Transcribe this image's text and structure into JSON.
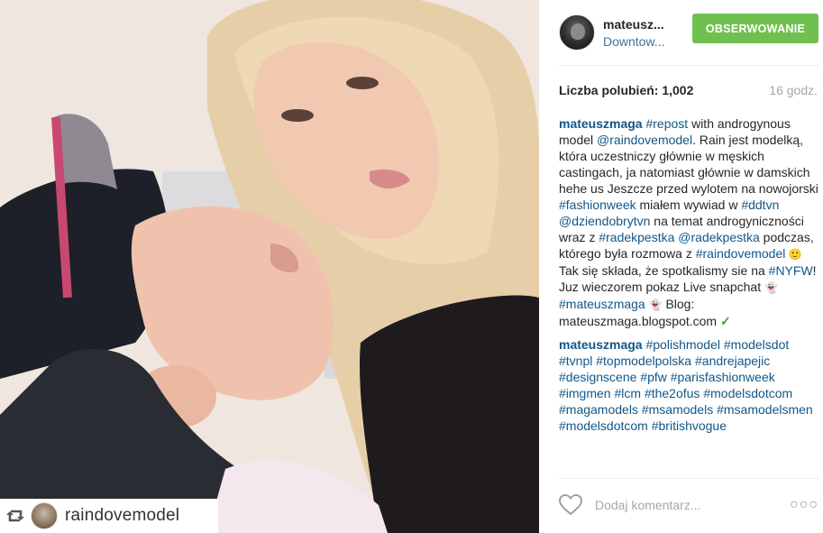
{
  "photo": {
    "repost": {
      "icon": "repost-icon",
      "username": "raindovemodel"
    }
  },
  "post": {
    "author": {
      "username": "mateusz...",
      "location": "Downtow..."
    },
    "follow_label": "OBSERWOWANIE",
    "likes_label": "Liczba polubień: 1,002",
    "time_label": "16 godz.",
    "comments": [
      {
        "user": "mateuszmaga",
        "segments": [
          {
            "t": "tag",
            "v": "#repost"
          },
          {
            "t": "text",
            "v": " with androgynous model "
          },
          {
            "t": "tag",
            "v": "@raindovemodel"
          },
          {
            "t": "text",
            "v": ". Rain jest modelką, która uczestniczy głównie w męskich castingach, ja natomiast głównie w damskich hehe us Jeszcze przed wylotem na nowojorski "
          },
          {
            "t": "tag",
            "v": "#fashionweek"
          },
          {
            "t": "text",
            "v": " miałem wywiad w "
          },
          {
            "t": "tag",
            "v": "#ddtvn"
          },
          {
            "t": "text",
            "v": " "
          },
          {
            "t": "tag",
            "v": "@dziendobrytvn"
          },
          {
            "t": "text",
            "v": " na temat androgyniczności wraz z "
          },
          {
            "t": "tag",
            "v": "#radekpestka"
          },
          {
            "t": "text",
            "v": " "
          },
          {
            "t": "tag",
            "v": "@radekpestka"
          },
          {
            "t": "text",
            "v": " podczas, którego była rozmowa z "
          },
          {
            "t": "tag",
            "v": "#raindovemodel"
          },
          {
            "t": "emoji",
            "v": " 🙂"
          },
          {
            "t": "text",
            "v": " Tak się składa, że spotkalismy sie na "
          },
          {
            "t": "tag",
            "v": "#NYFW"
          },
          {
            "t": "text",
            "v": "! Juz wieczorem pokaz Live snapchat "
          },
          {
            "t": "emoji",
            "v": "👻"
          },
          {
            "t": "text",
            "v": " "
          },
          {
            "t": "tag",
            "v": "#mateuszmaga"
          },
          {
            "t": "text",
            "v": " "
          },
          {
            "t": "emoji",
            "v": "👻"
          },
          {
            "t": "text",
            "v": " Blog: mateuszmaga.blogspot.com "
          },
          {
            "t": "check",
            "v": "✓"
          }
        ]
      },
      {
        "user": "mateuszmaga",
        "segments": [
          {
            "t": "tag",
            "v": "#polishmodel"
          },
          {
            "t": "text",
            "v": " "
          },
          {
            "t": "tag",
            "v": "#modelsdot"
          },
          {
            "t": "text",
            "v": " "
          },
          {
            "t": "tag",
            "v": "#tvnpl"
          },
          {
            "t": "text",
            "v": " "
          },
          {
            "t": "tag",
            "v": "#topmodelpolska"
          },
          {
            "t": "text",
            "v": " "
          },
          {
            "t": "tag",
            "v": "#andrejapejic"
          },
          {
            "t": "text",
            "v": " "
          },
          {
            "t": "tag",
            "v": "#designscene"
          },
          {
            "t": "text",
            "v": " "
          },
          {
            "t": "tag",
            "v": "#pfw"
          },
          {
            "t": "text",
            "v": " "
          },
          {
            "t": "tag",
            "v": "#parisfashionweek"
          },
          {
            "t": "text",
            "v": " "
          },
          {
            "t": "tag",
            "v": "#imgmen"
          },
          {
            "t": "text",
            "v": " "
          },
          {
            "t": "tag",
            "v": "#lcm"
          },
          {
            "t": "text",
            "v": " "
          },
          {
            "t": "tag",
            "v": "#the2ofus"
          },
          {
            "t": "text",
            "v": " "
          },
          {
            "t": "tag",
            "v": "#modelsdotcom"
          },
          {
            "t": "text",
            "v": " "
          },
          {
            "t": "tag",
            "v": "#magamodels"
          },
          {
            "t": "text",
            "v": " "
          },
          {
            "t": "tag",
            "v": "#msamodels"
          },
          {
            "t": "text",
            "v": " "
          },
          {
            "t": "tag",
            "v": "#msamodelsmen"
          },
          {
            "t": "text",
            "v": " "
          },
          {
            "t": "tag",
            "v": "#modelsdotcom"
          },
          {
            "t": "text",
            "v": " "
          },
          {
            "t": "tag",
            "v": "#britishvogue"
          }
        ]
      }
    ],
    "footer": {
      "like_icon": "heart-icon",
      "comment_placeholder": "Dodaj komentarz...",
      "more_label": "○○○"
    }
  },
  "colors": {
    "follow_button": "#70c050",
    "link": "#125688",
    "location": "#3f729b",
    "muted": "#a5a7aa"
  }
}
